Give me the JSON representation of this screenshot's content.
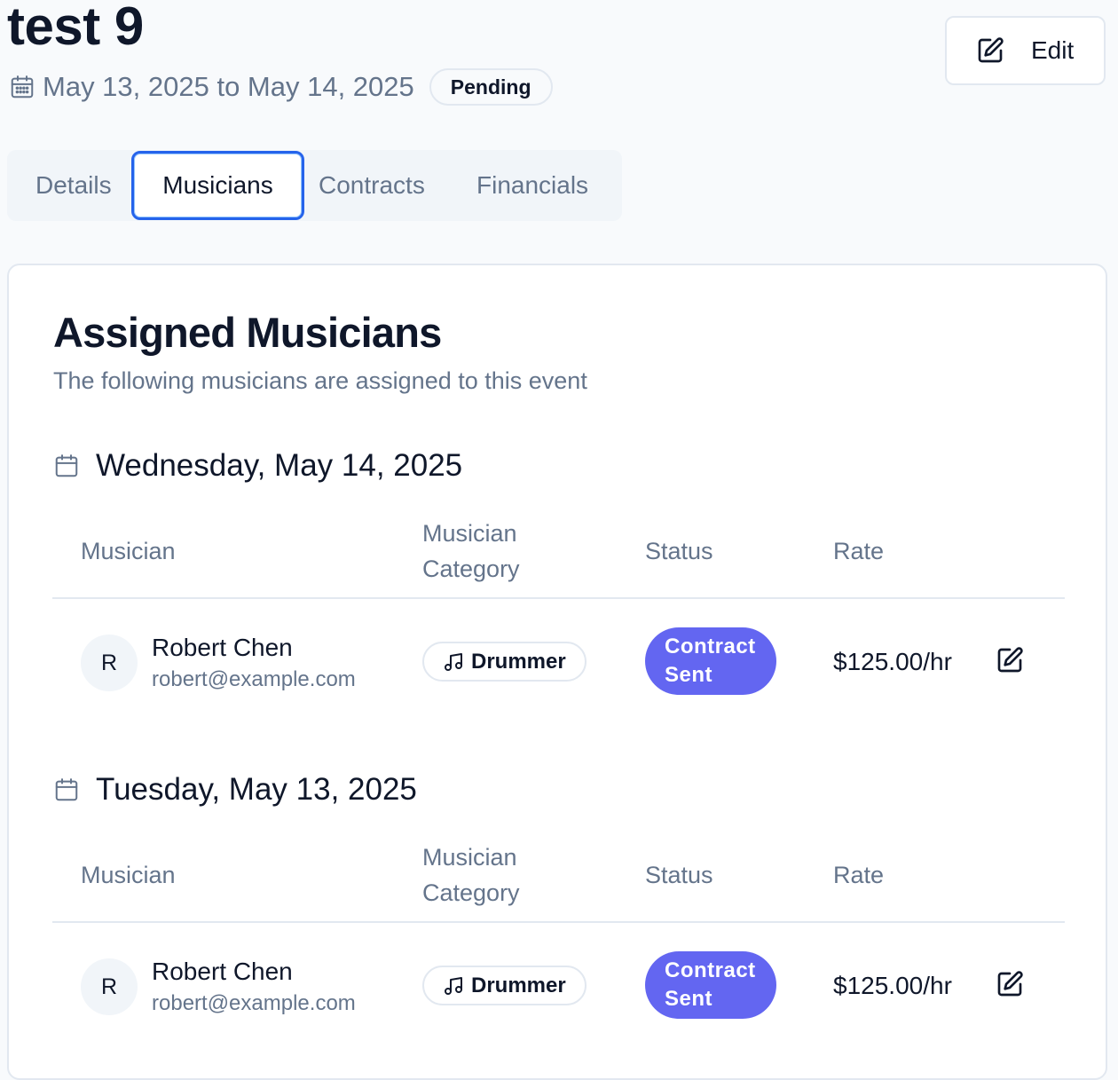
{
  "header": {
    "title": "test 9",
    "date_range": "May 13, 2025 to May 14, 2025",
    "status": "Pending",
    "edit_label": "Edit",
    "calendar_icon": "calendar-icon",
    "edit_icon": "edit-icon"
  },
  "tabs": [
    {
      "label": "Details",
      "active": false
    },
    {
      "label": "Musicians",
      "active": true
    },
    {
      "label": "Contracts",
      "active": false
    },
    {
      "label": "Financials",
      "active": false
    }
  ],
  "card": {
    "title": "Assigned Musicians",
    "description": "The following musicians are assigned to this event",
    "columns": {
      "musician": "Musician",
      "category_line1": "Musician",
      "category_line2": "Category",
      "status": "Status",
      "rate": "Rate"
    },
    "days": [
      {
        "date": "Wednesday, May 14, 2025",
        "musicians": [
          {
            "initial": "R",
            "name": "Robert Chen",
            "email": "robert@example.com",
            "category": "Drummer",
            "category_icon": "music-note-icon",
            "status_line1": "Contract",
            "status_line2": "Sent",
            "rate": "$125.00/hr"
          }
        ]
      },
      {
        "date": "Tuesday, May 13, 2025",
        "musicians": [
          {
            "initial": "R",
            "name": "Robert Chen",
            "email": "robert@example.com",
            "category": "Drummer",
            "category_icon": "music-note-icon",
            "status_line1": "Contract",
            "status_line2": "Sent",
            "rate": "$125.00/hr"
          }
        ]
      }
    ]
  },
  "colors": {
    "accent": "#2563eb",
    "status_badge": "#6366f1",
    "muted_text": "#64748b",
    "background": "#f8fafc"
  }
}
